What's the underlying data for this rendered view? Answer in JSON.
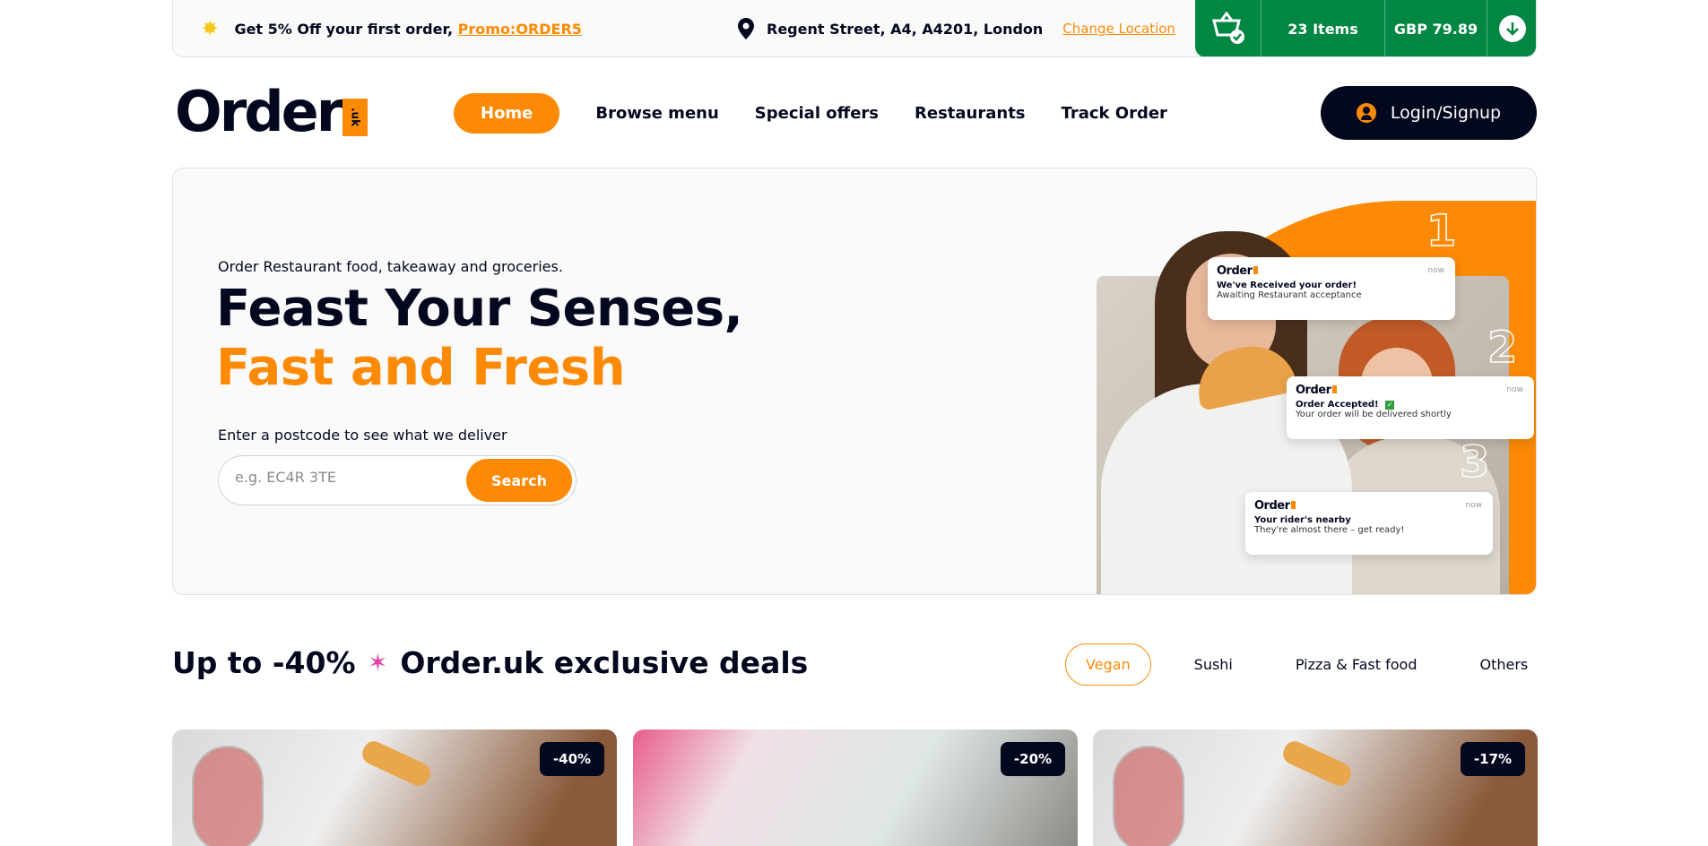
{
  "topbar": {
    "promo_text": "Get 5% Off your first order,",
    "promo_code": "Promo:ORDER5",
    "location": "Regent Street, A4, A4201, London",
    "change_location": "Change Location",
    "cart_items": "23 Items",
    "cart_total": "GBP 79.89"
  },
  "header": {
    "logo_text": "Order",
    "logo_suffix": ".uk",
    "nav": [
      "Home",
      "Browse menu",
      "Special offers",
      "Restaurants",
      "Track Order"
    ],
    "login": "Login/Signup"
  },
  "hero": {
    "subtitle": "Order Restaurant food, takeaway and groceries.",
    "title_line1": "Feast Your Senses,",
    "title_line2": "Fast and Fresh",
    "postcode_label": "Enter a postcode to see what we deliver",
    "search_placeholder": "e.g. EC4R 3TE",
    "search_button": "Search",
    "steps": [
      "1",
      "2",
      "3"
    ],
    "notifications": [
      {
        "brand": "Order",
        "time": "now",
        "title": "We've Received your order!",
        "desc": "Awaiting Restaurant acceptance"
      },
      {
        "brand": "Order",
        "time": "now",
        "title": "Order Accepted!",
        "desc": "Your order will be delivered shortly"
      },
      {
        "brand": "Order",
        "time": "now",
        "title": "Your rider's nearby",
        "desc": "They're almost there – get ready!"
      }
    ]
  },
  "deals": {
    "title_prefix": "Up to -40%",
    "title_suffix": "Order.uk exclusive deals",
    "categories": [
      "Vegan",
      "Sushi",
      "Pizza & Fast food",
      "Others"
    ],
    "cards": [
      {
        "discount": "-40%"
      },
      {
        "discount": "-20%"
      },
      {
        "discount": "-17%"
      }
    ]
  },
  "colors": {
    "accent": "#fc8a06",
    "dark": "#03081f",
    "green": "#028643"
  }
}
